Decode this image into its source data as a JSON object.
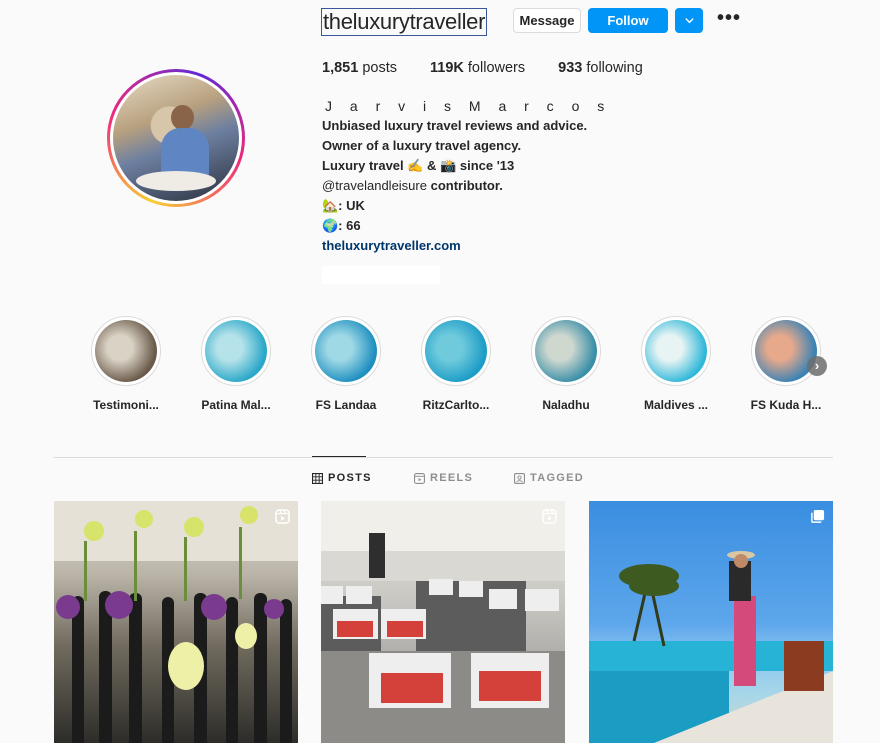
{
  "profile": {
    "username": "theluxurytraveller",
    "message_label": "Message",
    "follow_label": "Follow",
    "more_label": "•••",
    "stats": {
      "posts_value": "1,851",
      "posts_label": "posts",
      "followers_value": "119K",
      "followers_label": "followers",
      "following_value": "933",
      "following_label": "following"
    },
    "full_name": "J a r v i s M a r c o s",
    "bio_lines": [
      "Unbiased luxury travel reviews and advice.",
      "Owner of a luxury travel agency.",
      "Luxury travel ✍️ & 📸 since '13"
    ],
    "mention": "@travelandleisure",
    "mention_suffix": "contributor.",
    "home_line": "🏡: UK",
    "globe_line": "🌍: 66",
    "website": "theluxurytraveller.com"
  },
  "highlights": [
    {
      "label": "Testimoni...",
      "color_a": "#6b5a4a",
      "color_b": "#d9d2c5"
    },
    {
      "label": "Patina Mal...",
      "color_a": "#2aa7c9",
      "color_b": "#b6e3ea"
    },
    {
      "label": "FS Landaa",
      "color_a": "#1f8fbf",
      "color_b": "#9fd9e6"
    },
    {
      "label": "RitzCarlto...",
      "color_a": "#1d9cc7",
      "color_b": "#6fcbdc"
    },
    {
      "label": "Naladhu",
      "color_a": "#3a8fa8",
      "color_b": "#cfd8cf"
    },
    {
      "label": "Maldives ...",
      "color_a": "#31b8d8",
      "color_b": "#e8f4f4"
    },
    {
      "label": "FS Kuda H...",
      "color_a": "#3a82b5",
      "color_b": "#e6a98c"
    }
  ],
  "tabs": [
    {
      "label": "POSTS",
      "icon": "grid-icon",
      "active": true
    },
    {
      "label": "REELS",
      "icon": "reels-icon",
      "active": false
    },
    {
      "label": "TAGGED",
      "icon": "tagged-icon",
      "active": false
    }
  ],
  "posts": [
    {
      "type": "reel",
      "icon": "reel-icon"
    },
    {
      "type": "reel",
      "icon": "reel-icon"
    },
    {
      "type": "carousel",
      "icon": "carousel-icon"
    }
  ],
  "colors": {
    "accent": "#0095f6",
    "link": "#00376b",
    "text": "#262626",
    "muted": "#8e8e8e",
    "border": "#dbdbdb"
  }
}
